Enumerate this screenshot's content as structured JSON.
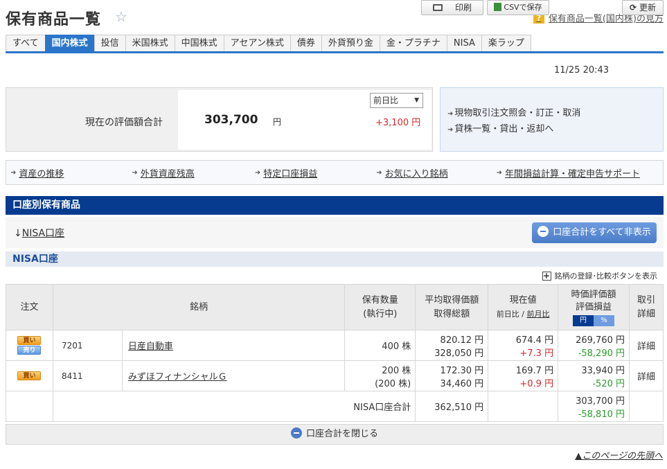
{
  "header": {
    "title": "保有商品一覧",
    "help_label": "保有商品一覧(国内株)の見方"
  },
  "tabs": [
    {
      "label": "すべて"
    },
    {
      "label": "国内株式",
      "active": true
    },
    {
      "label": "投信"
    },
    {
      "label": "米国株式"
    },
    {
      "label": "中国株式"
    },
    {
      "label": "アセアン株式"
    },
    {
      "label": "債券"
    },
    {
      "label": "外貨預り金"
    },
    {
      "label": "金・プラチナ"
    },
    {
      "label": "NISA"
    },
    {
      "label": "楽ラップ"
    }
  ],
  "toolbar": {
    "print_label": "印刷",
    "csv_label": "CSVで保存",
    "timestamp": "11/25 20:43",
    "update_label": "更新"
  },
  "summary": {
    "label": "現在の評価額合計",
    "value": "303,700",
    "unit": "円",
    "compare_selected": "前日比",
    "change": "+3,100 円"
  },
  "side_links": [
    "現物取引注文照会・訂正・取消",
    "貸株一覧・貸出・返却へ"
  ],
  "link_bar": [
    "資産の推移",
    "外貨資産残高",
    "特定口座損益",
    "お気に入り銘柄",
    "年間損益計算・確定申告サポート"
  ],
  "section": {
    "title": "口座別保有商品",
    "nisa_link_prefix": "↓",
    "nisa_link": "NISA口座",
    "hide_all_label": "口座合計をすべて非表示",
    "nisa_heading": "NISA口座",
    "register_label": "銘柄の登録･比較ボタンを表示"
  },
  "table": {
    "headers": {
      "order": "注文",
      "name": "銘柄",
      "qty_line1": "保有数量",
      "qty_line2": "(執行中)",
      "avg_line1": "平均取得価額",
      "avg_line2": "取得総額",
      "price_line1": "現在値",
      "price_day": "前日比",
      "price_sep": "/",
      "price_month": "前月比",
      "eval_line1": "時価評価額",
      "eval_line2": "評価損益",
      "toggle_yen": "円",
      "toggle_pct": "%",
      "detail_line1": "取引",
      "detail_line2": "詳細"
    },
    "rows": [
      {
        "buy": "買い",
        "sell": "売り",
        "code": "7201",
        "name": "日産自動車",
        "qty": "400 株",
        "qty_pending": "",
        "avg_price": "820.12 円",
        "total_cost": "328,050 円",
        "price": "674.4 円",
        "price_change": "+7.3 円",
        "market_value": "269,760 円",
        "pl": "-58,290 円",
        "detail": "詳細"
      },
      {
        "buy": "買い",
        "sell": "",
        "code": "8411",
        "name": "みずほフィナンシャルＧ",
        "qty": "200 株",
        "qty_pending": "(200 株)",
        "avg_price": "172.30 円",
        "total_cost": "34,460 円",
        "price": "169.7 円",
        "price_change": "+0.9 円",
        "market_value": "33,940 円",
        "pl": "-520 円",
        "detail": "詳細"
      }
    ],
    "total": {
      "label": "NISA口座合計",
      "total_cost": "362,510 円",
      "market_value": "303,700 円",
      "pl": "-58,810 円"
    }
  },
  "footer": {
    "close_label": "口座合計を閉じる",
    "page_top": "▲このページの先頭へ"
  },
  "colors": {
    "tab_active": "#2a75c9",
    "section_bar": "#063b8f",
    "gain": "#d42b2b",
    "loss": "#2b9b2b"
  }
}
